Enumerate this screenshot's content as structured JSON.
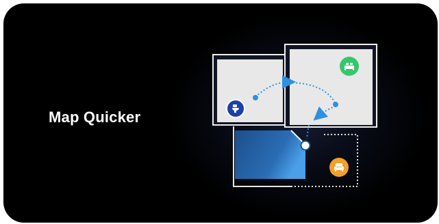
{
  "card": {
    "title": "Map Quicker"
  },
  "colors": {
    "background": "#000000",
    "toilet_pin": "#1e3fa8",
    "bed_pin": "#35c76a",
    "sofa_pin": "#f2a02a",
    "path": "#2f8fe0",
    "room_fill": "#e8e8e8",
    "wall": "#f2f2f2"
  },
  "icons": {
    "toilet": "toilet-icon",
    "bed": "bed-icon",
    "sofa": "sofa-icon"
  }
}
